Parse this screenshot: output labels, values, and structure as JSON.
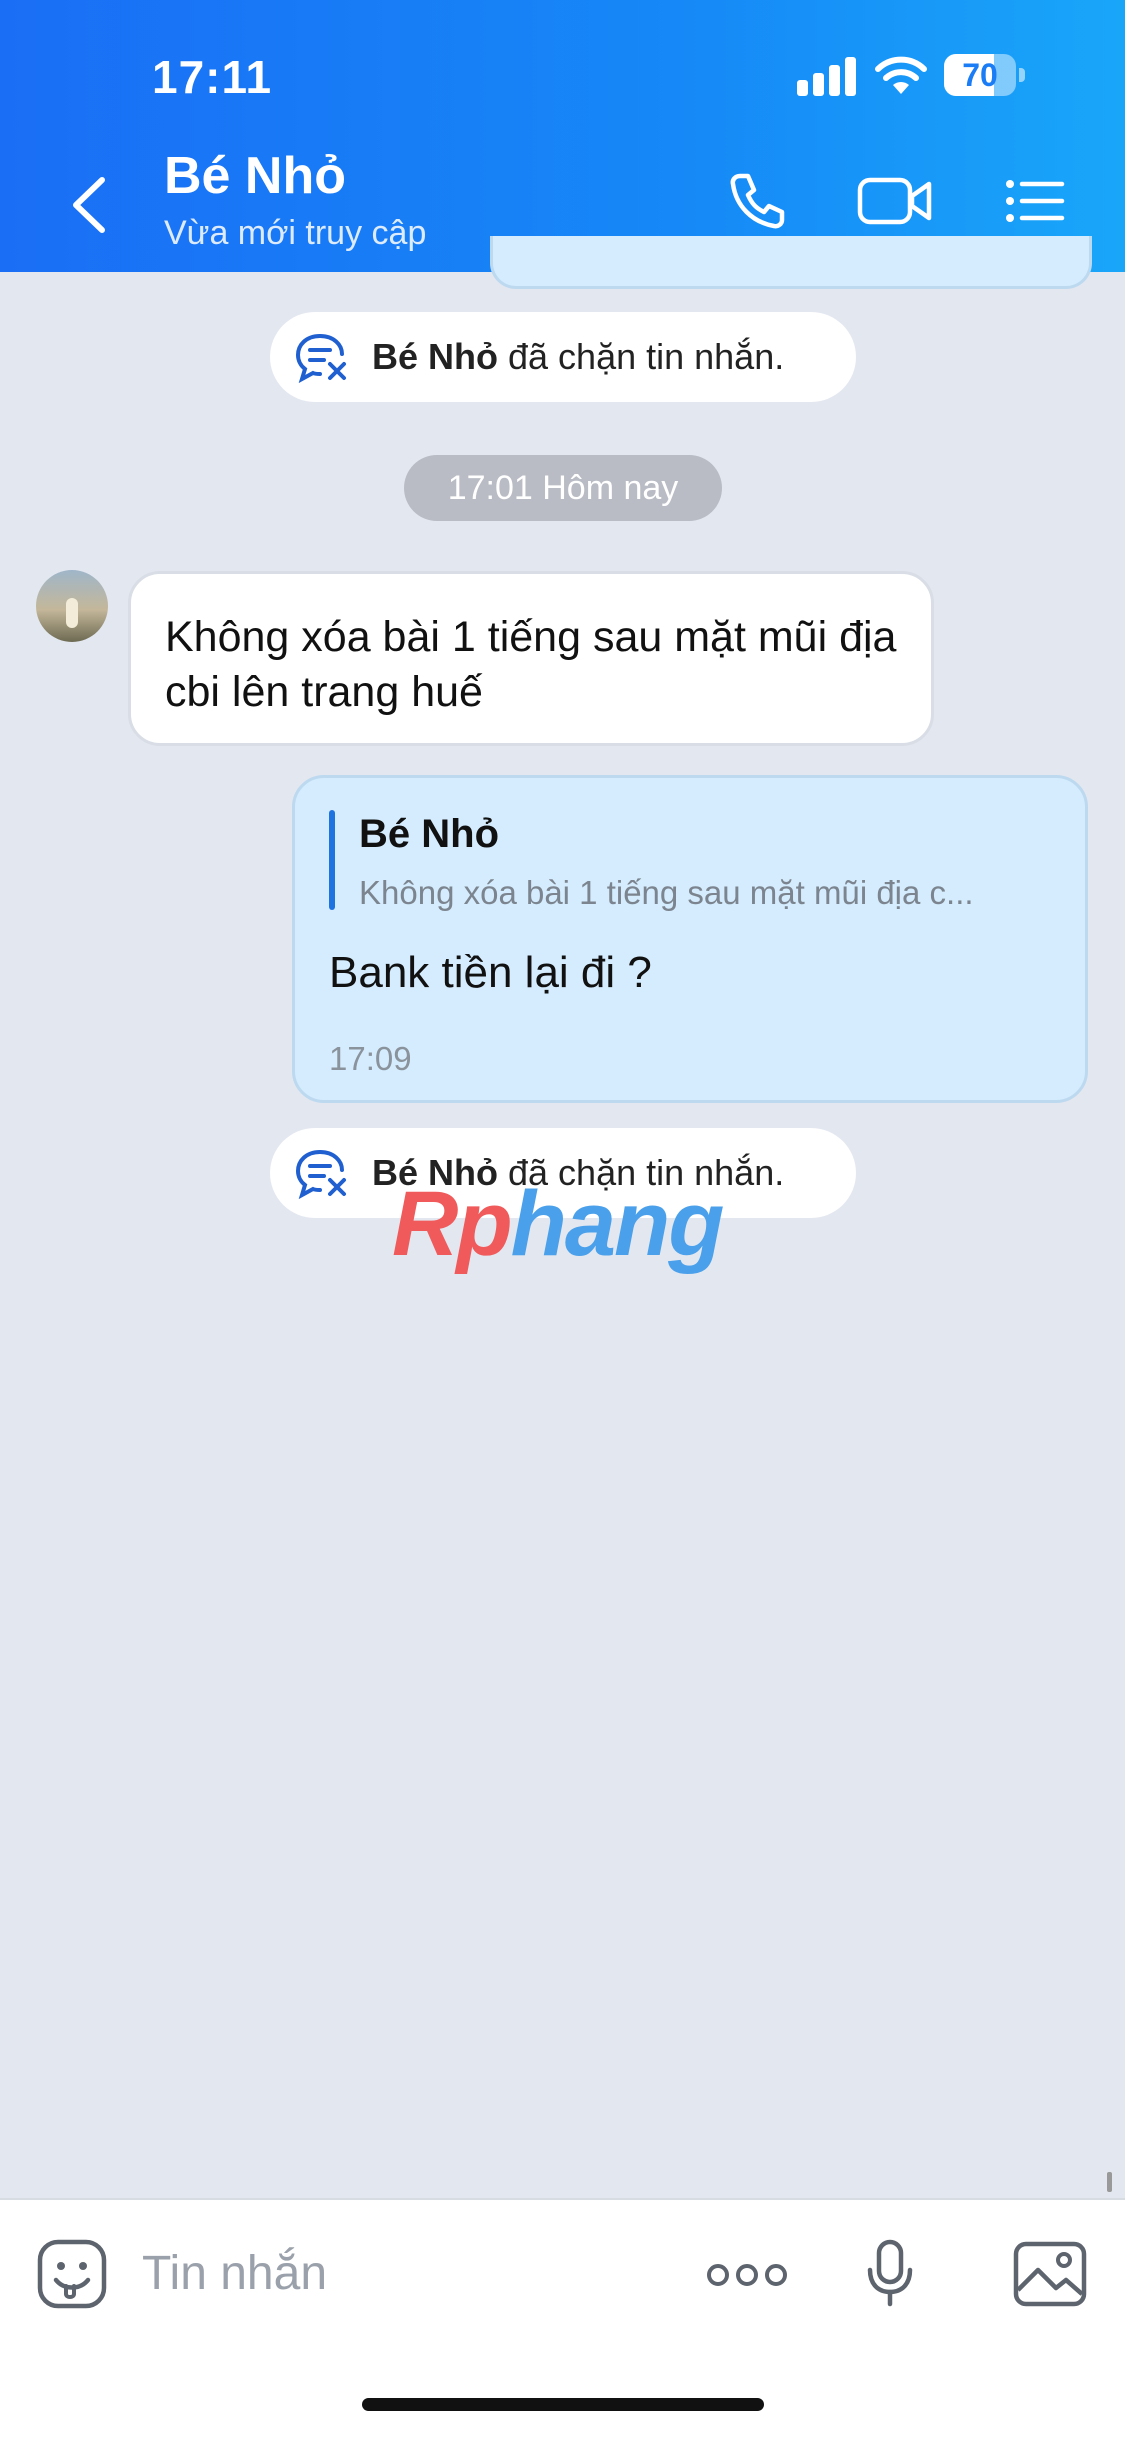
{
  "status_bar": {
    "time": "17:11",
    "battery": "70",
    "battery_level": 0.7
  },
  "header": {
    "back_icon": "chevron-left-icon",
    "contact_name": "Bé Nhỏ",
    "contact_status": "Vừa mới truy cập",
    "call_icon": "phone-icon",
    "video_icon": "video-camera-icon",
    "menu_icon": "list-menu-icon"
  },
  "messages": {
    "blocked_notice_1": {
      "name": "Bé Nhỏ",
      "text": " đã chặn tin nhắn."
    },
    "time_separator": "17:01 Hôm nay",
    "incoming": {
      "text": "Không xóa bài 1 tiếng sau mặt mũi địa cbi lên trang huế"
    },
    "outgoing": {
      "quote_name": "Bé Nhỏ",
      "quote_text": "Không xóa bài 1 tiếng sau mặt mũi địa c...",
      "text": "Bank tiền lại đi ?",
      "time": "17:09"
    },
    "blocked_notice_2": {
      "name": "Bé Nhỏ",
      "text": " đã chặn tin nhắn."
    }
  },
  "watermark": {
    "part1": "Rp",
    "part2": "hang"
  },
  "input_bar": {
    "placeholder": "Tin nhắn",
    "sticker_icon": "sticker-face-icon",
    "more_icon": "more-dots-icon",
    "mic_icon": "microphone-icon",
    "image_icon": "image-gallery-icon"
  },
  "colors": {
    "header_start": "#1a6ef5",
    "header_end": "#19a6f9",
    "outgoing_bubble": "#d4ecfd",
    "background": "#e3e7f0"
  }
}
